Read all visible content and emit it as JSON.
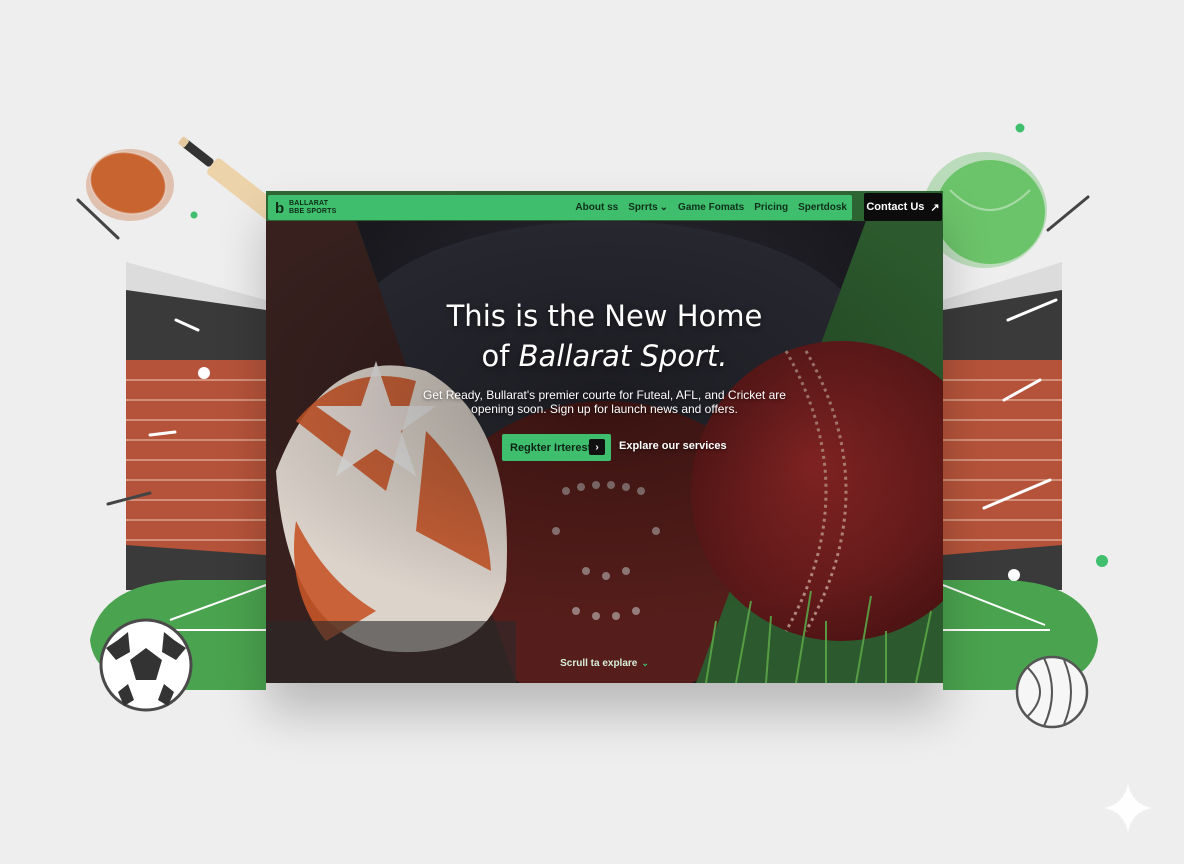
{
  "colors": {
    "brand_green": "#3fbf6e",
    "dark": "#0c0c0c",
    "brick": "#b5533a",
    "field": "#4aa34e",
    "background": "#eeeeee"
  },
  "nav": {
    "logo_line1": "BALLARAT",
    "logo_line2": "BBE SPORTS",
    "links": [
      "About ss",
      "Sprrts",
      "Game Fomats",
      "Pricing",
      "Spertdosk"
    ],
    "contact_label": "Contact Us"
  },
  "hero": {
    "title_line1": "This is the New Home",
    "title_line2_prefix": "of ",
    "title_line2_emphasis": "Ballarat Sport.",
    "subtitle": "Get Ready, Bullarat's premier courte for Futeal, AFL, and Cricket are opening soon. Sign up for launch news and offers.",
    "primary_cta": "Regkter Irterest",
    "secondary_cta": "Explare our services",
    "scroll_hint": "Scrull ta explare"
  },
  "icons": {
    "logo": "logo-icon",
    "contact_arrow": "arrow-up-right-icon",
    "register_arrow": "chevron-right-icon",
    "nav_dropdown": "chevron-down-icon",
    "scroll": "chevron-down-icon"
  }
}
